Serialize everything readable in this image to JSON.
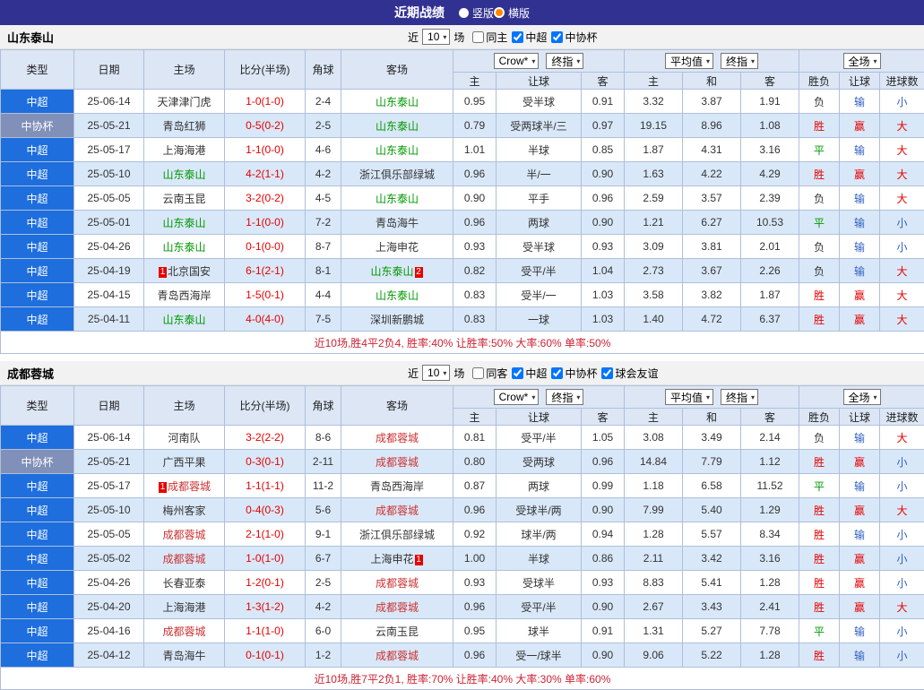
{
  "topbar": {
    "title": "近期战绩",
    "view_options": [
      {
        "label": "竖版",
        "selected": false
      },
      {
        "label": "横版",
        "selected": true
      }
    ]
  },
  "icons": {
    "chevron_down": "▾"
  },
  "colors": {
    "topbar_bg": "#313192",
    "radio_orange": "#ff8800",
    "league_csl": "#1e6ede",
    "league_cup": "#8090b8",
    "score_red": "#e60000",
    "draw_green": "#009900",
    "result_blue": "#3060c0",
    "summary_red": "#cc2233"
  },
  "table_header": {
    "static_cols": [
      "类型",
      "日期",
      "主场",
      "比分(半场)",
      "角球",
      "客场"
    ],
    "groups": [
      {
        "selects": [
          "Crow*",
          "终指"
        ],
        "cols": [
          "主",
          "让球",
          "客"
        ]
      },
      {
        "selects": [
          "平均值",
          "终指"
        ],
        "cols": [
          "主",
          "和",
          "客"
        ]
      },
      {
        "selects": [
          "全场"
        ],
        "cols": [
          "胜负",
          "让球",
          "进球数"
        ]
      }
    ]
  },
  "sections": [
    {
      "team": "山东泰山",
      "focus_color": "#009900",
      "filters": {
        "near_label": "近",
        "games": "10",
        "games_label": "场",
        "checkboxes": [
          {
            "label": "同主",
            "checked": false
          },
          {
            "label": "中超",
            "checked": true
          },
          {
            "label": "中协杯",
            "checked": true
          }
        ]
      },
      "rows": [
        {
          "league": "中超",
          "date": "25-06-14",
          "home": {
            "name": "天津津门虎"
          },
          "score": "1-0(1-0)",
          "corner": "2-4",
          "away": {
            "name": "山东泰山",
            "focus": true
          },
          "odds": [
            "0.95",
            "受半球",
            "0.91"
          ],
          "avg": [
            "3.32",
            "3.87",
            "1.91"
          ],
          "outcome": "负",
          "handicap": "输",
          "goals": "小"
        },
        {
          "league": "中协杯",
          "date": "25-05-21",
          "home": {
            "name": "青岛红狮"
          },
          "score": "0-5(0-2)",
          "corner": "2-5",
          "away": {
            "name": "山东泰山",
            "focus": true
          },
          "odds": [
            "0.79",
            "受两球半/三",
            "0.97"
          ],
          "avg": [
            "19.15",
            "8.96",
            "1.08"
          ],
          "outcome": "胜",
          "handicap": "赢",
          "goals": "大"
        },
        {
          "league": "中超",
          "date": "25-05-17",
          "home": {
            "name": "上海海港"
          },
          "score": "1-1(0-0)",
          "corner": "4-6",
          "away": {
            "name": "山东泰山",
            "focus": true
          },
          "odds": [
            "1.01",
            "半球",
            "0.85"
          ],
          "avg": [
            "1.87",
            "4.31",
            "3.16"
          ],
          "outcome": "平",
          "handicap": "输",
          "goals": "大"
        },
        {
          "league": "中超",
          "date": "25-05-10",
          "home": {
            "name": "山东泰山",
            "focus": true
          },
          "score": "4-2(1-1)",
          "corner": "4-2",
          "away": {
            "name": "浙江俱乐部绿城"
          },
          "odds": [
            "0.96",
            "半/一",
            "0.90"
          ],
          "avg": [
            "1.63",
            "4.22",
            "4.29"
          ],
          "outcome": "胜",
          "handicap": "赢",
          "goals": "大"
        },
        {
          "league": "中超",
          "date": "25-05-05",
          "home": {
            "name": "云南玉昆"
          },
          "score": "3-2(0-2)",
          "corner": "4-5",
          "away": {
            "name": "山东泰山",
            "focus": true
          },
          "odds": [
            "0.90",
            "平手",
            "0.96"
          ],
          "avg": [
            "2.59",
            "3.57",
            "2.39"
          ],
          "outcome": "负",
          "handicap": "输",
          "goals": "大"
        },
        {
          "league": "中超",
          "date": "25-05-01",
          "home": {
            "name": "山东泰山",
            "focus": true
          },
          "score": "1-1(0-0)",
          "corner": "7-2",
          "away": {
            "name": "青岛海牛"
          },
          "odds": [
            "0.96",
            "两球",
            "0.90"
          ],
          "avg": [
            "1.21",
            "6.27",
            "10.53"
          ],
          "outcome": "平",
          "handicap": "输",
          "goals": "小"
        },
        {
          "league": "中超",
          "date": "25-04-26",
          "home": {
            "name": "山东泰山",
            "focus": true
          },
          "score": "0-1(0-0)",
          "corner": "8-7",
          "away": {
            "name": "上海申花"
          },
          "odds": [
            "0.93",
            "受半球",
            "0.93"
          ],
          "avg": [
            "3.09",
            "3.81",
            "2.01"
          ],
          "outcome": "负",
          "handicap": "输",
          "goals": "小"
        },
        {
          "league": "中超",
          "date": "25-04-19",
          "home": {
            "name": "北京国安",
            "badge_before": "1"
          },
          "score": "6-1(2-1)",
          "corner": "8-1",
          "away": {
            "name": "山东泰山",
            "focus": true,
            "badge_after": "2"
          },
          "odds": [
            "0.82",
            "受平/半",
            "1.04"
          ],
          "avg": [
            "2.73",
            "3.67",
            "2.26"
          ],
          "outcome": "负",
          "handicap": "输",
          "goals": "大"
        },
        {
          "league": "中超",
          "date": "25-04-15",
          "home": {
            "name": "青岛西海岸"
          },
          "score": "1-5(0-1)",
          "corner": "4-4",
          "away": {
            "name": "山东泰山",
            "focus": true
          },
          "odds": [
            "0.83",
            "受半/一",
            "1.03"
          ],
          "avg": [
            "3.58",
            "3.82",
            "1.87"
          ],
          "outcome": "胜",
          "handicap": "赢",
          "goals": "大"
        },
        {
          "league": "中超",
          "date": "25-04-11",
          "home": {
            "name": "山东泰山",
            "focus": true
          },
          "score": "4-0(4-0)",
          "corner": "7-5",
          "away": {
            "name": "深圳新鹏城"
          },
          "odds": [
            "0.83",
            "一球",
            "1.03"
          ],
          "avg": [
            "1.40",
            "4.72",
            "6.37"
          ],
          "outcome": "胜",
          "handicap": "赢",
          "goals": "大"
        }
      ],
      "summary": "近10场,胜4平2负4, 胜率:40% 让胜率:50% 大率:60% 单率:50%"
    },
    {
      "team": "成都蓉城",
      "focus_color": "#cc3333",
      "filters": {
        "near_label": "近",
        "games": "10",
        "games_label": "场",
        "checkboxes": [
          {
            "label": "同客",
            "checked": false
          },
          {
            "label": "中超",
            "checked": true
          },
          {
            "label": "中协杯",
            "checked": true
          },
          {
            "label": "球会友谊",
            "checked": true
          }
        ]
      },
      "rows": [
        {
          "league": "中超",
          "date": "25-06-14",
          "home": {
            "name": "河南队"
          },
          "score": "3-2(2-2)",
          "corner": "8-6",
          "away": {
            "name": "成都蓉城",
            "focus": true
          },
          "odds": [
            "0.81",
            "受平/半",
            "1.05"
          ],
          "avg": [
            "3.08",
            "3.49",
            "2.14"
          ],
          "outcome": "负",
          "handicap": "输",
          "goals": "大"
        },
        {
          "league": "中协杯",
          "date": "25-05-21",
          "home": {
            "name": "广西平果"
          },
          "score": "0-3(0-1)",
          "corner": "2-11",
          "away": {
            "name": "成都蓉城",
            "focus": true
          },
          "odds": [
            "0.80",
            "受两球",
            "0.96"
          ],
          "avg": [
            "14.84",
            "7.79",
            "1.12"
          ],
          "outcome": "胜",
          "handicap": "赢",
          "goals": "小"
        },
        {
          "league": "中超",
          "date": "25-05-17",
          "home": {
            "name": "成都蓉城",
            "focus": true,
            "badge_before": "1"
          },
          "score": "1-1(1-1)",
          "corner": "11-2",
          "away": {
            "name": "青岛西海岸"
          },
          "odds": [
            "0.87",
            "两球",
            "0.99"
          ],
          "avg": [
            "1.18",
            "6.58",
            "11.52"
          ],
          "outcome": "平",
          "handicap": "输",
          "goals": "小"
        },
        {
          "league": "中超",
          "date": "25-05-10",
          "home": {
            "name": "梅州客家"
          },
          "score": "0-4(0-3)",
          "corner": "5-6",
          "away": {
            "name": "成都蓉城",
            "focus": true
          },
          "odds": [
            "0.96",
            "受球半/两",
            "0.90"
          ],
          "avg": [
            "7.99",
            "5.40",
            "1.29"
          ],
          "outcome": "胜",
          "handicap": "赢",
          "goals": "大"
        },
        {
          "league": "中超",
          "date": "25-05-05",
          "home": {
            "name": "成都蓉城",
            "focus": true
          },
          "score": "2-1(1-0)",
          "corner": "9-1",
          "away": {
            "name": "浙江俱乐部绿城"
          },
          "odds": [
            "0.92",
            "球半/两",
            "0.94"
          ],
          "avg": [
            "1.28",
            "5.57",
            "8.34"
          ],
          "outcome": "胜",
          "handicap": "输",
          "goals": "小"
        },
        {
          "league": "中超",
          "date": "25-05-02",
          "home": {
            "name": "成都蓉城",
            "focus": true
          },
          "score": "1-0(1-0)",
          "corner": "6-7",
          "away": {
            "name": "上海申花",
            "badge_after": "1"
          },
          "odds": [
            "1.00",
            "半球",
            "0.86"
          ],
          "avg": [
            "2.11",
            "3.42",
            "3.16"
          ],
          "outcome": "胜",
          "handicap": "赢",
          "goals": "小"
        },
        {
          "league": "中超",
          "date": "25-04-26",
          "home": {
            "name": "长春亚泰"
          },
          "score": "1-2(0-1)",
          "corner": "2-5",
          "away": {
            "name": "成都蓉城",
            "focus": true
          },
          "odds": [
            "0.93",
            "受球半",
            "0.93"
          ],
          "avg": [
            "8.83",
            "5.41",
            "1.28"
          ],
          "outcome": "胜",
          "handicap": "赢",
          "goals": "小"
        },
        {
          "league": "中超",
          "date": "25-04-20",
          "home": {
            "name": "上海海港"
          },
          "score": "1-3(1-2)",
          "corner": "4-2",
          "away": {
            "name": "成都蓉城",
            "focus": true
          },
          "odds": [
            "0.96",
            "受平/半",
            "0.90"
          ],
          "avg": [
            "2.67",
            "3.43",
            "2.41"
          ],
          "outcome": "胜",
          "handicap": "赢",
          "goals": "大"
        },
        {
          "league": "中超",
          "date": "25-04-16",
          "home": {
            "name": "成都蓉城",
            "focus": true
          },
          "score": "1-1(1-0)",
          "corner": "6-0",
          "away": {
            "name": "云南玉昆"
          },
          "odds": [
            "0.95",
            "球半",
            "0.91"
          ],
          "avg": [
            "1.31",
            "5.27",
            "7.78"
          ],
          "outcome": "平",
          "handicap": "输",
          "goals": "小"
        },
        {
          "league": "中超",
          "date": "25-04-12",
          "home": {
            "name": "青岛海牛"
          },
          "score": "0-1(0-1)",
          "corner": "1-2",
          "away": {
            "name": "成都蓉城",
            "focus": true
          },
          "odds": [
            "0.96",
            "受一/球半",
            "0.90"
          ],
          "avg": [
            "9.06",
            "5.22",
            "1.28"
          ],
          "outcome": "胜",
          "handicap": "输",
          "goals": "小"
        }
      ],
      "summary": "近10场,胜7平2负1, 胜率:70% 让胜率:40% 大率:30% 单率:60%"
    }
  ]
}
